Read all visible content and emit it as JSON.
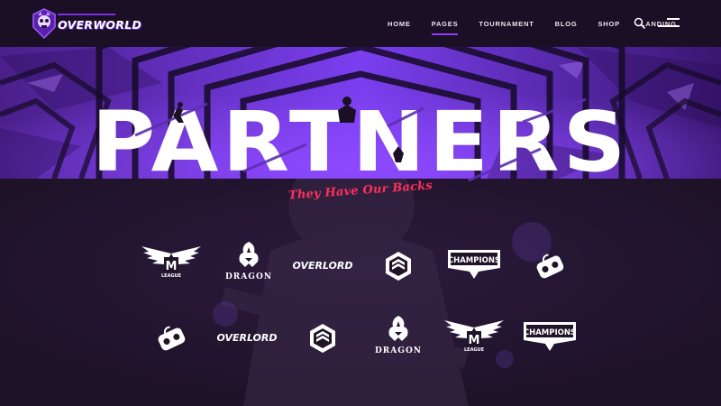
{
  "brand": {
    "name": "OVERWORLD"
  },
  "nav": {
    "items": [
      {
        "label": "HOME"
      },
      {
        "label": "PAGES",
        "active": true
      },
      {
        "label": "TOURNAMENT"
      },
      {
        "label": "BLOG"
      },
      {
        "label": "SHOP"
      },
      {
        "label": "LANDING"
      }
    ],
    "icons": [
      "search-icon",
      "menu-icon"
    ]
  },
  "hero": {
    "title": "PARTNERS",
    "tagline": "They Have Our Backs"
  },
  "partners": {
    "row1": [
      {
        "name": "mleague-logo",
        "text": "LEAGUE"
      },
      {
        "name": "dragon-logo",
        "text": "DRAGON"
      },
      {
        "name": "overlord-logo",
        "text": "OVERLORD"
      },
      {
        "name": "hexagon-logo",
        "text": ""
      },
      {
        "name": "champions-logo",
        "text": "CHAMPIONS"
      },
      {
        "name": "gamepad-logo",
        "text": ""
      }
    ],
    "row2": [
      {
        "name": "gamepad-logo",
        "text": ""
      },
      {
        "name": "overlord-logo",
        "text": "OVERLORD"
      },
      {
        "name": "hexagon-logo",
        "text": ""
      },
      {
        "name": "dragon-logo",
        "text": "DRAGON"
      },
      {
        "name": "mleague-logo",
        "text": "LEAGUE"
      },
      {
        "name": "champions-logo",
        "text": "CHAMPIONS"
      }
    ]
  },
  "colors": {
    "background": "#1f1328",
    "header": "#1b0f25",
    "accent_purple": "#8f3cf6",
    "tagline_red": "#ff2f5f"
  }
}
